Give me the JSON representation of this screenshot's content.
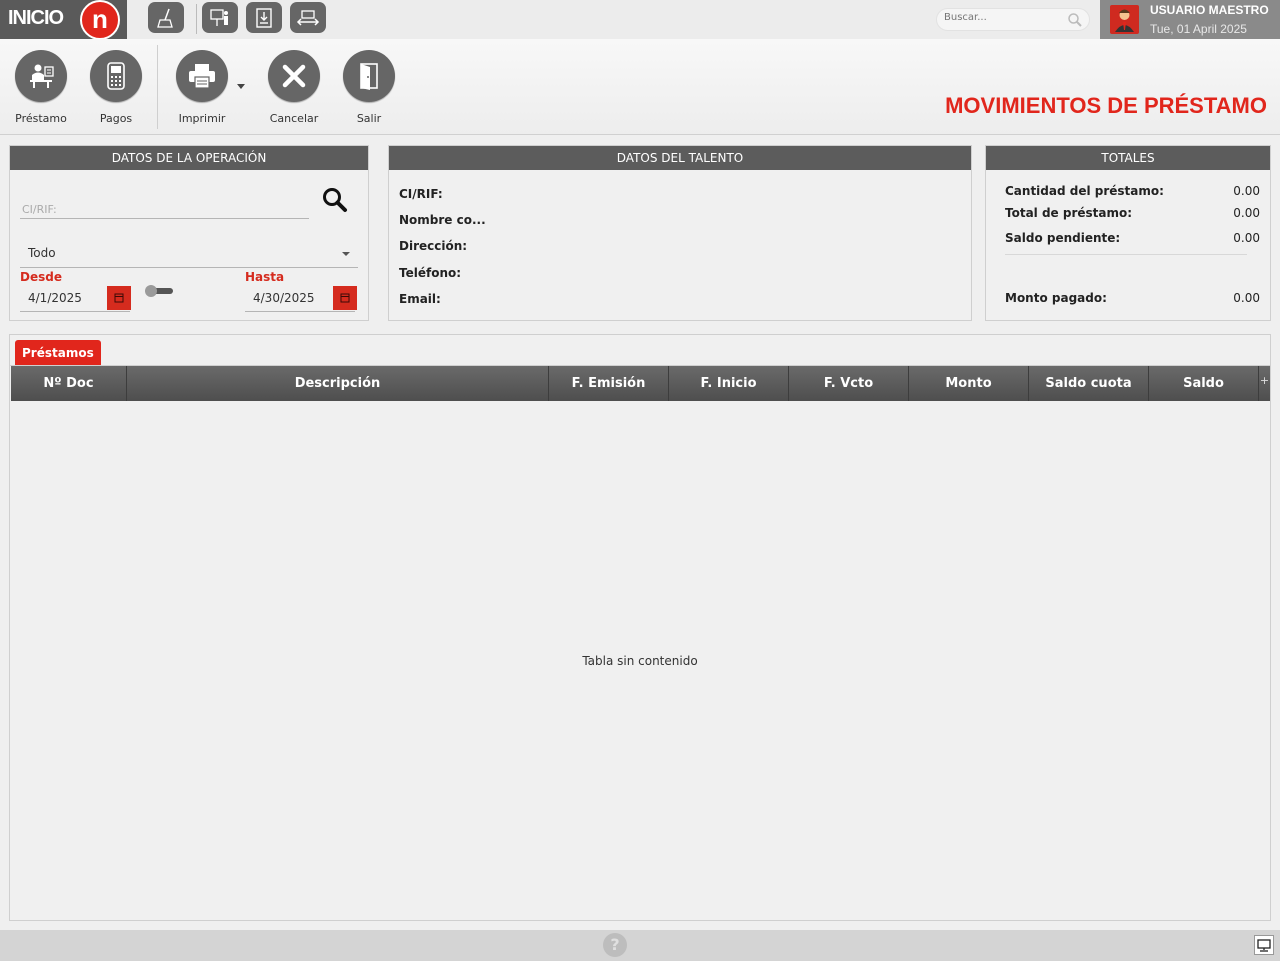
{
  "topbar": {
    "logo_text": "INICIO",
    "logo_letter": "n",
    "search_placeholder": "Buscar...",
    "user_name": "USUARIO MAESTRO",
    "user_date": "Tue, 01 April 2025",
    "quick_icons": [
      "broom-icon",
      "presentation-icon",
      "document-download-icon",
      "transfer-icon"
    ]
  },
  "toolbar": {
    "prestamo_label": "Préstamo",
    "pagos_label": "Pagos",
    "imprimir_label": "Imprimir",
    "cancelar_label": "Cancelar",
    "salir_label": "Salir",
    "page_title": "MOVIMIENTOS DE PRÉSTAMO"
  },
  "operacion": {
    "title": "DATOS DE LA OPERACIÓN",
    "cirif_placeholder": "CI/RIF:",
    "filter_value": "Todo",
    "desde_label": "Desde",
    "desde_value": "4/1/2025",
    "hasta_label": "Hasta",
    "hasta_value": "4/30/2025",
    "toggle_on": false
  },
  "talento": {
    "title": "DATOS DEL TALENTO",
    "cirif_label": "CI/RIF:",
    "nombre_label": "Nombre co...",
    "direccion_label": "Dirección:",
    "telefono_label": "Teléfono:",
    "email_label": "Email:"
  },
  "totales": {
    "title": "TOTALES",
    "cantidad_label": "Cantidad del préstamo:",
    "cantidad_value": "0.00",
    "total_label": "Total de préstamo:",
    "total_value": "0.00",
    "saldo_label": "Saldo pendiente:",
    "saldo_value": "0.00",
    "monto_label": "Monto pagado:",
    "monto_value": "0.00"
  },
  "table": {
    "tab_label": "Préstamos",
    "columns": [
      "Nº Doc",
      "Descripción",
      "F. Emisión",
      "F. Inicio",
      "F. Vcto",
      "Monto",
      "Saldo cuota",
      "Saldo"
    ],
    "plus": "+",
    "empty_message": "Tabla sin contenido"
  },
  "statusbar": {
    "help": "?"
  },
  "colors": {
    "accent": "#e1261c",
    "header_dark": "#5c5c5c"
  }
}
